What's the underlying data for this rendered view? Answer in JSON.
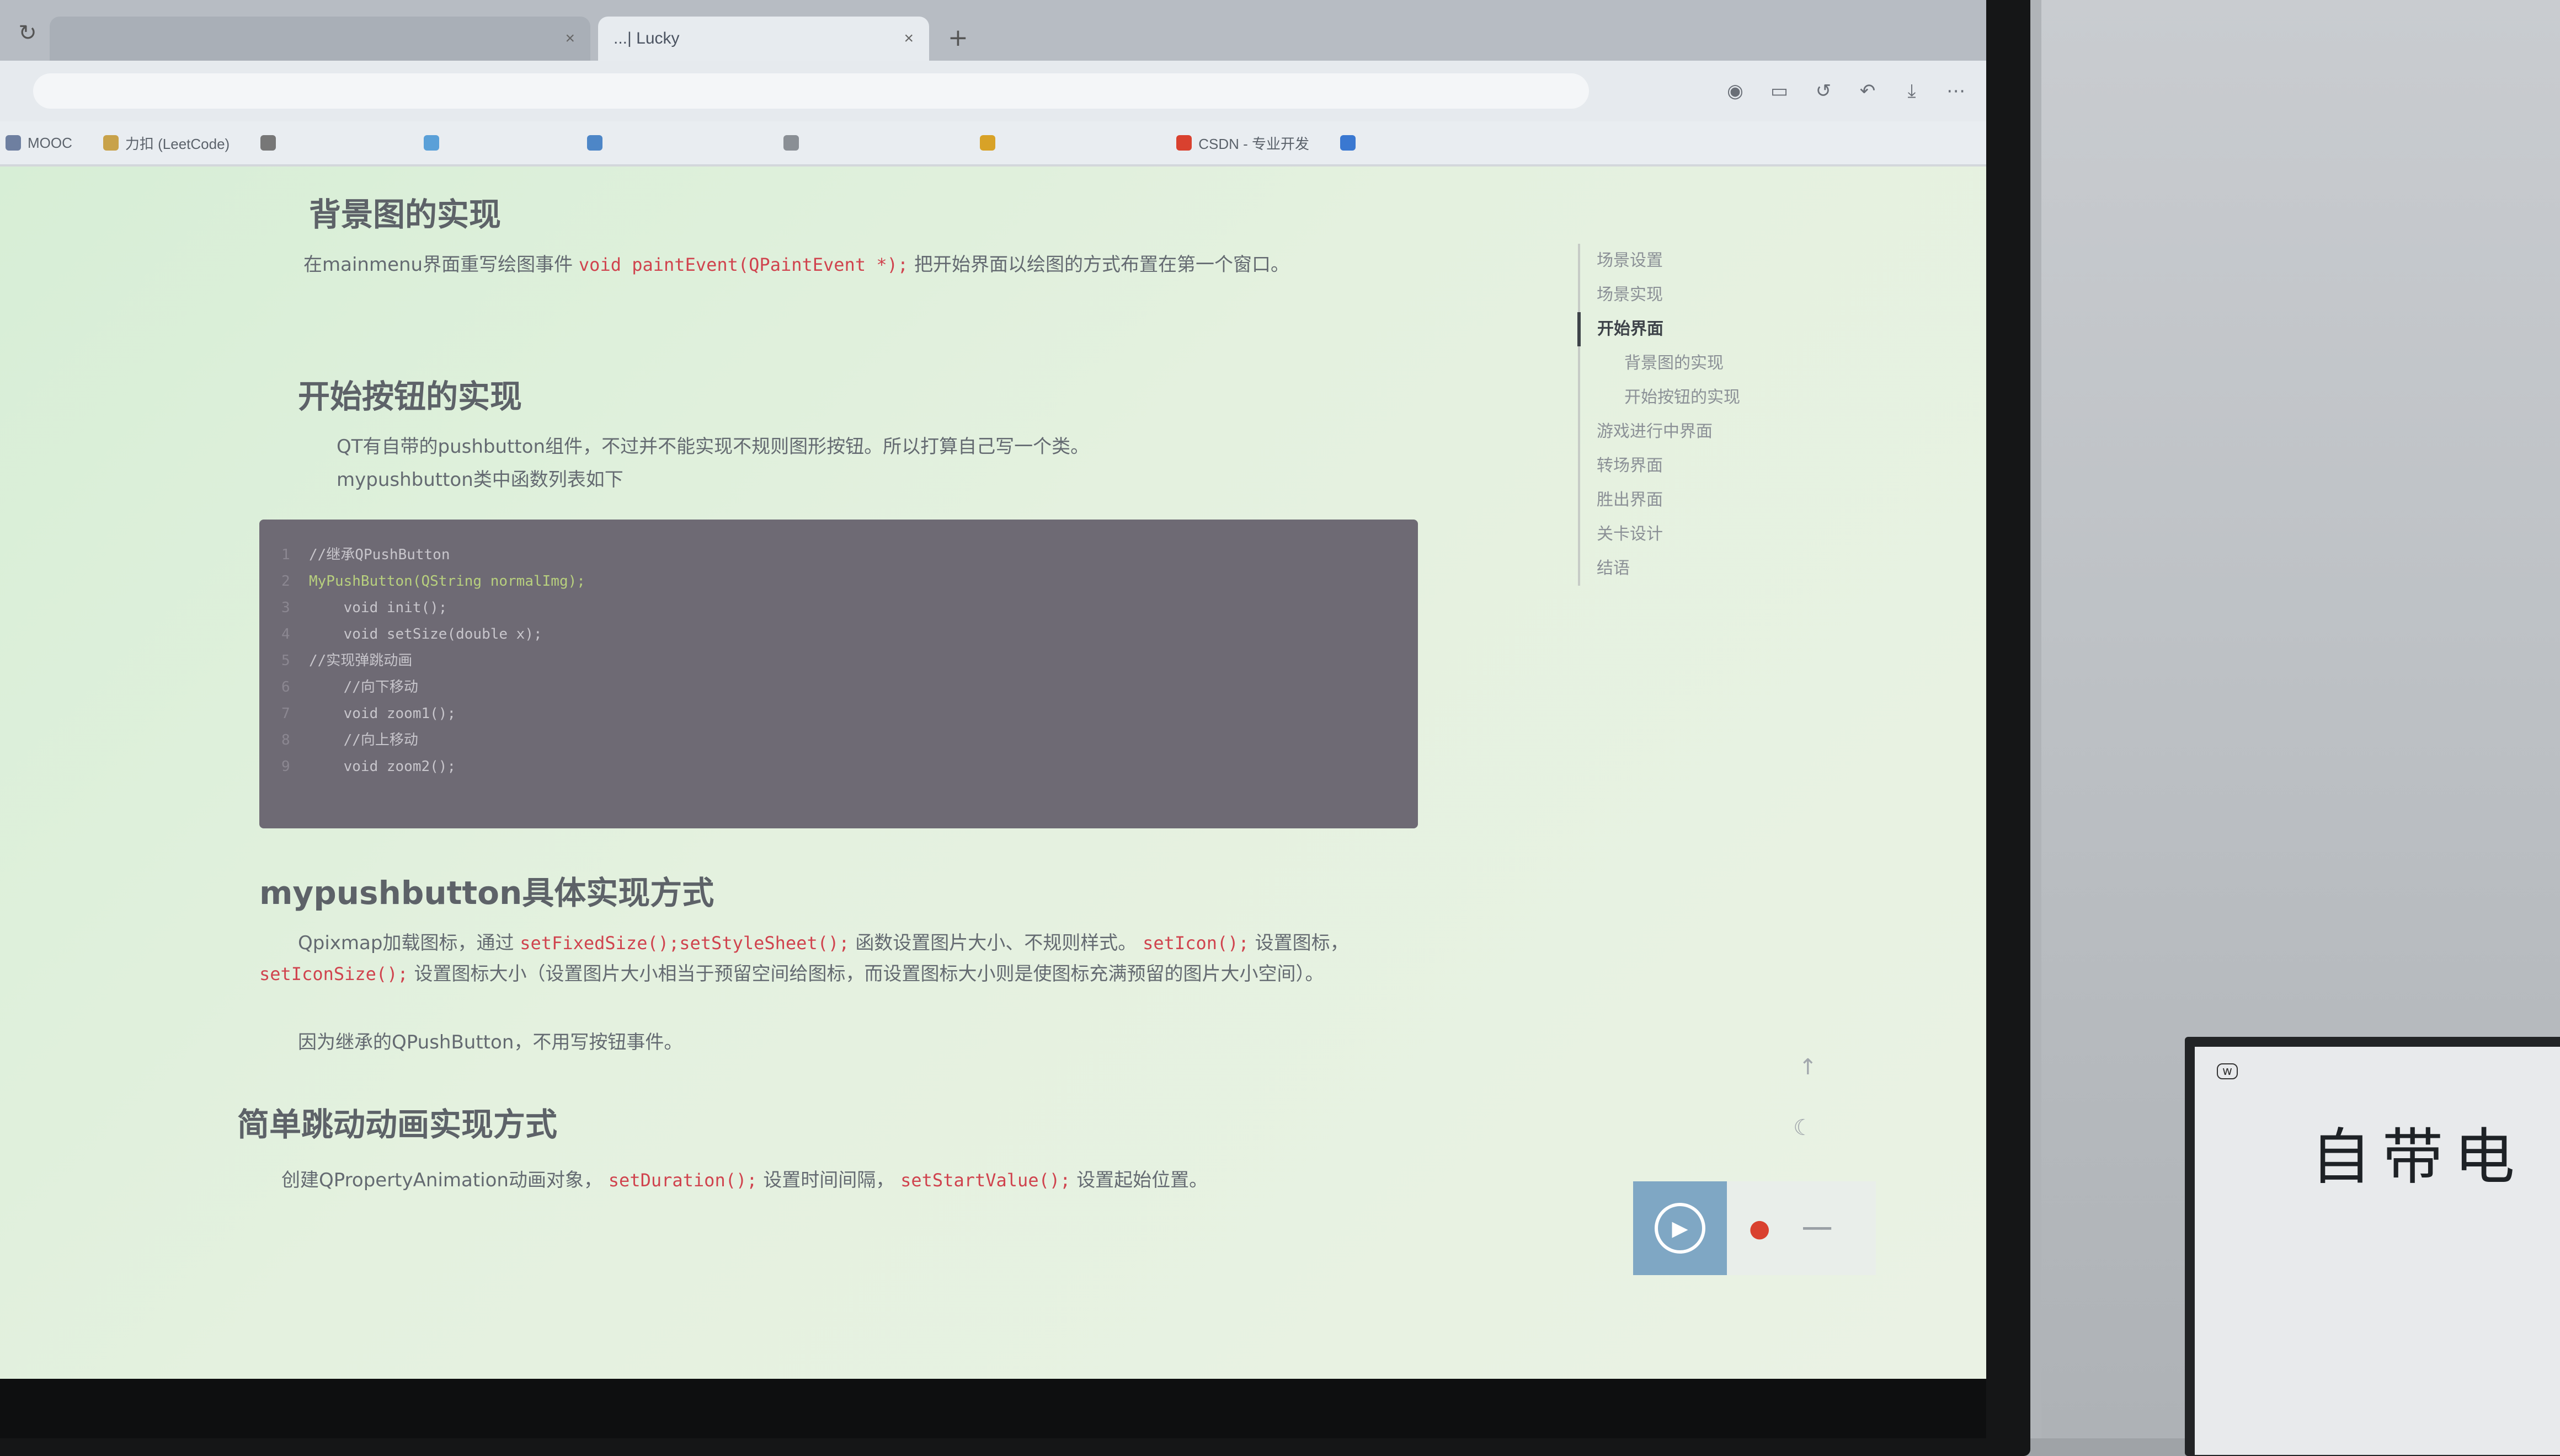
{
  "browser": {
    "tabs": [
      {
        "label": "",
        "active": false
      },
      {
        "label": "...| Lucky",
        "active": true
      }
    ],
    "address_placeholder": "",
    "bookmarks": [
      {
        "label": "MOOC",
        "color": "#6e7fa0"
      },
      {
        "label": "力扣 (LeetCode)",
        "color": "#c8a24a"
      },
      {
        "label": "",
        "color": "#777777"
      },
      {
        "label": "",
        "color": "#5aa0d8"
      },
      {
        "label": "",
        "color": "#4d86c7"
      },
      {
        "label": "",
        "color": "#8a8f95"
      },
      {
        "label": "",
        "color": "#d8a227"
      },
      {
        "label": "CSDN - 专业开发",
        "color": "#d9412f"
      },
      {
        "label": "",
        "color": "#3a78d1"
      }
    ]
  },
  "article": {
    "h_background": "背景图的实现",
    "p_background_pre": "在mainmenu界面重写绘图事件",
    "p_background_code": "void paintEvent(QPaintEvent *);",
    "p_background_post": "把开始界面以绘图的方式布置在第一个窗口。",
    "h_start_button": "开始按钮的实现",
    "p_start_1": "QT有自带的pushbutton组件，不过并不能实现不规则图形按钮。所以打算自己写一个类。",
    "p_start_2": "mypushbutton类中函数列表如下",
    "code_lines": [
      {
        "n": "1",
        "t": "//继承QPushButton"
      },
      {
        "n": "2",
        "t": "MyPushButton(QString normalImg);"
      },
      {
        "n": "3",
        "t": "    void init();"
      },
      {
        "n": "4",
        "t": "    void setSize(double x);"
      },
      {
        "n": "5",
        "t": "//实现弹跳动画"
      },
      {
        "n": "6",
        "t": "    //向下移动"
      },
      {
        "n": "7",
        "t": "    void zoom1();"
      },
      {
        "n": "8",
        "t": "    //向上移动"
      },
      {
        "n": "9",
        "t": "    void zoom2();"
      }
    ],
    "h_mypushbutton": "mypushbutton具体实现方式",
    "p_mpb_pre": "Qpixmap加载图标，通过",
    "p_mpb_code1": "setFixedSize();setStyleSheet();",
    "p_mpb_mid1": "函数设置图片大小、不规则样式。",
    "p_mpb_code2": "setIcon();",
    "p_mpb_mid2": "设置图标，",
    "p_mpb_code3": "setIconSize();",
    "p_mpb_post": "设置图标大小（设置图片大小相当于预留空间给图标，而设置图标大小则是使图标充满预留的图片大小空间）。",
    "p_mpb_2": "因为继承的QPushButton，不用写按钮事件。",
    "h_animation": "简单跳动动画实现方式",
    "p_anim_pre": "创建QPropertyAnimation动画对象，",
    "p_anim_code1": "setDuration();",
    "p_anim_mid": "设置时间间隔，",
    "p_anim_code2": "setStartValue();",
    "p_anim_post": "设置起始位置。"
  },
  "toc": [
    {
      "label": "场景设置",
      "level": 1,
      "active": false
    },
    {
      "label": "场景实现",
      "level": 1,
      "active": false
    },
    {
      "label": "开始界面",
      "level": 1,
      "active": true
    },
    {
      "label": "背景图的实现",
      "level": 2,
      "active": false
    },
    {
      "label": "开始按钮的实现",
      "level": 2,
      "active": false
    },
    {
      "label": "游戏进行中界面",
      "level": 1,
      "active": false
    },
    {
      "label": "转场界面",
      "level": 1,
      "active": false
    },
    {
      "label": "胜出界面",
      "level": 1,
      "active": false
    },
    {
      "label": "关卡设计",
      "level": 1,
      "active": false
    },
    {
      "label": "结语",
      "level": 1,
      "active": false
    }
  ],
  "whiteboard": {
    "text": "自带电",
    "tag": "w"
  },
  "colors": {
    "page_bg": "#e4f1df",
    "code_bg": "#6e6a74",
    "inline_code": "#d0434e"
  }
}
